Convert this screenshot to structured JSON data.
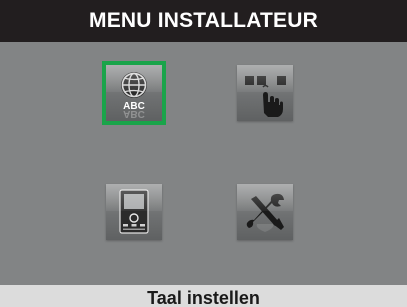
{
  "header": {
    "title": "MENU INSTALLATEUR"
  },
  "menu": {
    "items": [
      {
        "icon": "language-globe-icon",
        "label": "ABC",
        "mirror_label": "ABC",
        "selected": true
      },
      {
        "icon": "touch-keypad-icon",
        "selected": false
      },
      {
        "icon": "video-monitor-icon",
        "selected": false
      },
      {
        "icon": "tools-icon",
        "selected": false
      }
    ]
  },
  "status": {
    "selected_label": "Taal instellen"
  },
  "colors": {
    "header_bg": "#221e1f",
    "screen_bg": "#828485",
    "selection": "#1aa44a",
    "footer_bg": "#dcdcdc"
  }
}
